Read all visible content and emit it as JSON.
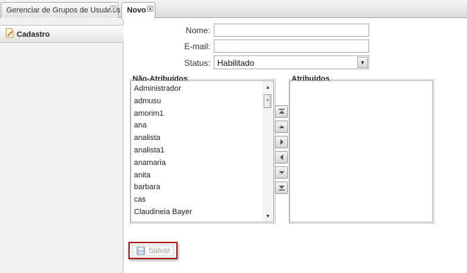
{
  "tabs": [
    {
      "label": "Gerenciar de Grupos de Usuários",
      "close": "x"
    },
    {
      "label": "Novo",
      "close": "x"
    }
  ],
  "sidebar": {
    "items": [
      {
        "label": "Cadastro",
        "icon": "document-edit-icon"
      }
    ]
  },
  "form": {
    "nome_label": "Nome:",
    "nome_value": "",
    "email_label": "E-mail:",
    "email_value": "",
    "status_label": "Status:",
    "status_value": "Habilitado"
  },
  "nao_atribuidos": {
    "title": "Não-Atribuídos",
    "items": [
      "Administrador",
      "admusu",
      "amorim1",
      "ana",
      "analista",
      "analista1",
      "anamaria",
      "anita",
      "barbara",
      "cas",
      "Claudineia Bayer"
    ]
  },
  "atribuidos": {
    "title": "Atribuídos",
    "items": []
  },
  "move_buttons": [
    "move-top-icon",
    "move-up-icon",
    "move-right-icon",
    "move-left-icon",
    "move-down-icon",
    "move-bottom-icon"
  ],
  "save": {
    "label": "Salvar",
    "enabled": false
  },
  "colors": {
    "highlight_border": "#a51d1d",
    "disabled_text": "#a8a8a8"
  }
}
